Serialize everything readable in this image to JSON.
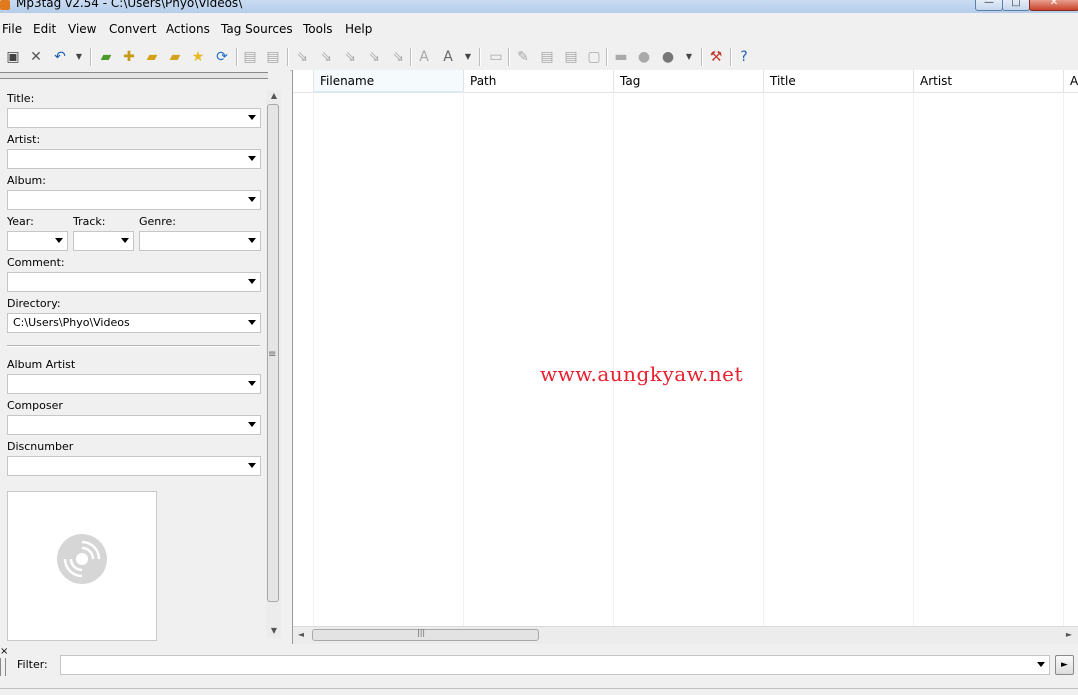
{
  "window": {
    "title": "Mp3tag v2.54  -  C:\\Users\\Phyo\\Videos\\",
    "minimize": "—",
    "maximize": "□",
    "close": "✕"
  },
  "menu": [
    "File",
    "Edit",
    "View",
    "Convert",
    "Actions",
    "Tag Sources",
    "Tools",
    "Help"
  ],
  "toolbar": {
    "icons": [
      "save-icon",
      "remove-icon",
      "undo-icon",
      "undo-dropdown-icon",
      "change-directory-icon",
      "add-directory-icon",
      "favorite-folder-icon",
      "open-folder-icon",
      "favorites-star-icon",
      "refresh-icon",
      "copy-tag-icon",
      "paste-tag-icon",
      "tag-filename-icon",
      "filename-tag-icon",
      "filename-filename-icon",
      "text-tag-icon",
      "tag-tag-icon",
      "autonumber-icon",
      "case-conversion-icon",
      "case-dropdown-icon",
      "extended-tags-icon",
      "edit-tag-icon",
      "export-icon",
      "playlist-icon",
      "freedb-icon",
      "discogs-icon",
      "tag-sources-icon",
      "tag-sources-dropdown-icon",
      "options-icon",
      "help-icon"
    ]
  },
  "tag_panel": {
    "title_label": "Title:",
    "artist_label": "Artist:",
    "album_label": "Album:",
    "year_label": "Year:",
    "track_label": "Track:",
    "genre_label": "Genre:",
    "comment_label": "Comment:",
    "directory_label": "Directory:",
    "directory_value": "C:\\Users\\Phyo\\Videos",
    "album_artist_label": "Album Artist",
    "composer_label": "Composer",
    "discnumber_label": "Discnumber",
    "cover_icon": "cd-disc-icon",
    "splitter_grip": "≡",
    "scroll_up": "▲",
    "scroll_down": "▼"
  },
  "file_list": {
    "columns": [
      "Filename",
      "Path",
      "Tag",
      "Title",
      "Artist",
      "A"
    ],
    "sorted_column": "Filename",
    "sort_indicator": "^",
    "rows": [],
    "hscroll_left": "◄",
    "hscroll_right": "►",
    "hscroll_grip": "|||"
  },
  "watermark": "www.aungkyaw.net",
  "filter": {
    "close": "×",
    "label": "Filter:",
    "value": "",
    "go": "►"
  }
}
